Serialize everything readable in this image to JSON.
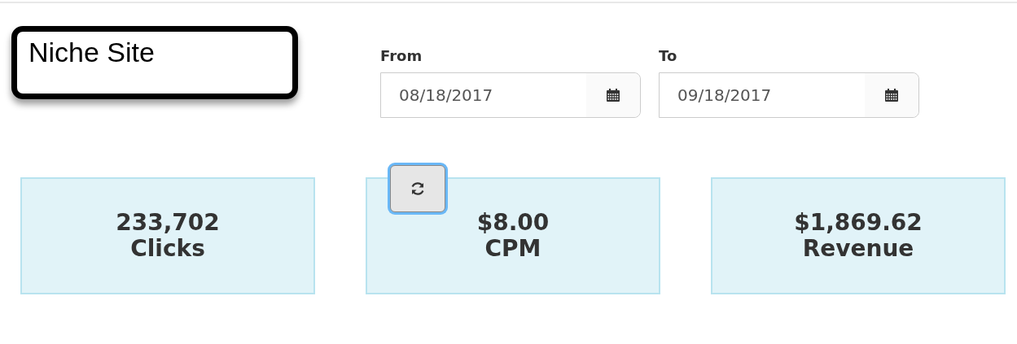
{
  "site_name": "Niche Site",
  "date_range": [
    {
      "label": "From",
      "value": "08/18/2017"
    },
    {
      "label": "To",
      "value": "09/18/2017"
    }
  ],
  "refresh_button": {
    "focused": true
  },
  "stats": [
    {
      "value": "233,702",
      "label": "Clicks"
    },
    {
      "value": "$8.00",
      "label": "CPM"
    },
    {
      "value": "$1,869.62",
      "label": "Revenue"
    }
  ]
}
